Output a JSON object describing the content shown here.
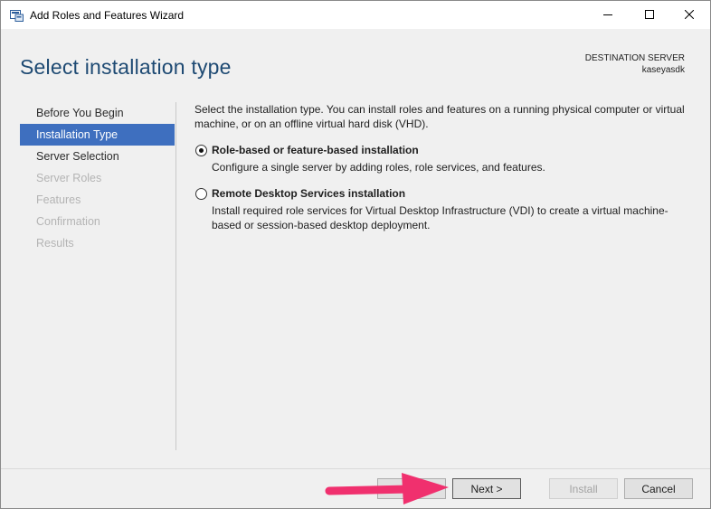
{
  "window": {
    "title": "Add Roles and Features Wizard"
  },
  "header": {
    "page_title": "Select installation type",
    "destination_label": "DESTINATION SERVER",
    "destination_server": "kaseyasdk"
  },
  "nav": {
    "items": [
      {
        "label": "Before You Begin",
        "state": "normal"
      },
      {
        "label": "Installation Type",
        "state": "active"
      },
      {
        "label": "Server Selection",
        "state": "normal"
      },
      {
        "label": "Server Roles",
        "state": "disabled"
      },
      {
        "label": "Features",
        "state": "disabled"
      },
      {
        "label": "Confirmation",
        "state": "disabled"
      },
      {
        "label": "Results",
        "state": "disabled"
      }
    ]
  },
  "content": {
    "intro": "Select the installation type. You can install roles and features on a running physical computer or virtual machine, or on an offline virtual hard disk (VHD).",
    "options": [
      {
        "title": "Role-based or feature-based installation",
        "description": "Configure a single server by adding roles, role services, and features.",
        "selected": true
      },
      {
        "title": "Remote Desktop Services installation",
        "description": "Install required role services for Virtual Desktop Infrastructure (VDI) to create a virtual machine-based or session-based desktop deployment.",
        "selected": false
      }
    ]
  },
  "footer": {
    "previous_label": "",
    "next_label": "Next >",
    "install_label": "Install",
    "cancel_label": "Cancel"
  },
  "icons": {
    "app": "server-manager-icon",
    "minimize": "minimize-icon",
    "maximize": "maximize-icon",
    "close": "close-icon",
    "annotation": "pink-arrow-icon"
  },
  "colors": {
    "title_blue": "#1e4a73",
    "nav_active": "#3e6fbf",
    "arrow": "#f0306e"
  }
}
